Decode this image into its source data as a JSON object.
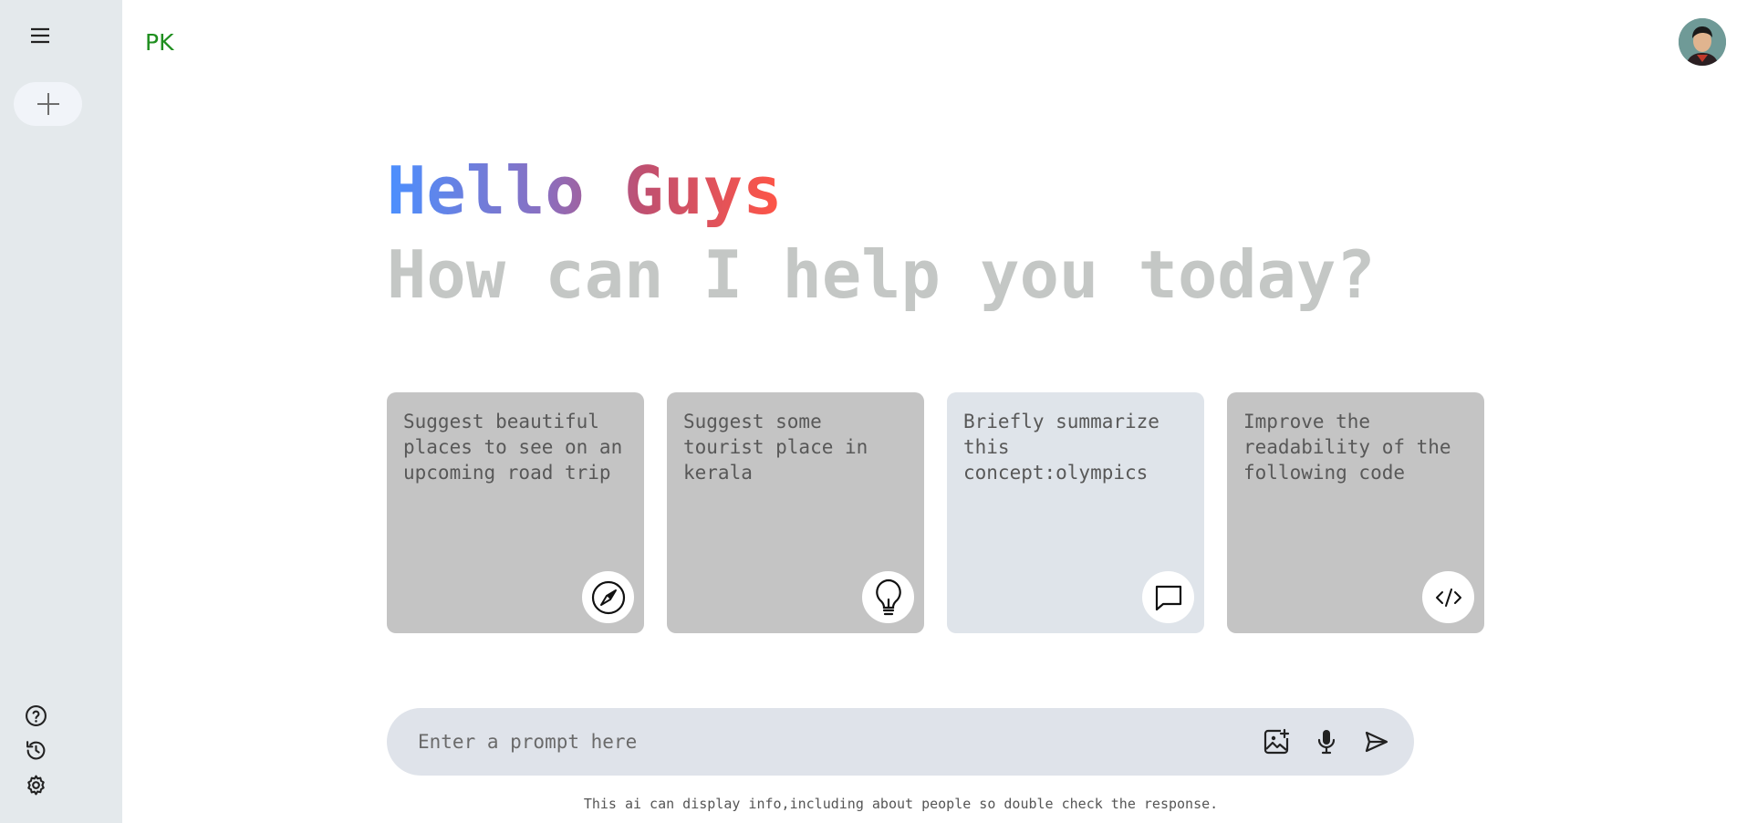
{
  "app": {
    "brand": "PK"
  },
  "greeting": {
    "hello": "Hello Guys",
    "question": "How can I help you today?"
  },
  "cards": [
    {
      "text": "Suggest beautiful places to see on an upcoming road trip",
      "icon": "compass-icon"
    },
    {
      "text": "Suggest some tourist place in kerala",
      "icon": "bulb-icon"
    },
    {
      "text": "Briefly summarize this concept:olympics",
      "icon": "message-icon"
    },
    {
      "text": "Improve the readability of the following code",
      "icon": "code-icon"
    }
  ],
  "prompt": {
    "placeholder": "Enter a prompt here"
  },
  "disclaimer": "This ai can display info,including about people so double check the response.",
  "colors": {
    "sidebar": "#e4e9ec",
    "card": "#c4c4c4",
    "card_active": "#dfe4ea",
    "brand": "#1e8e1e",
    "prompt_bg": "#dfe3ea"
  }
}
